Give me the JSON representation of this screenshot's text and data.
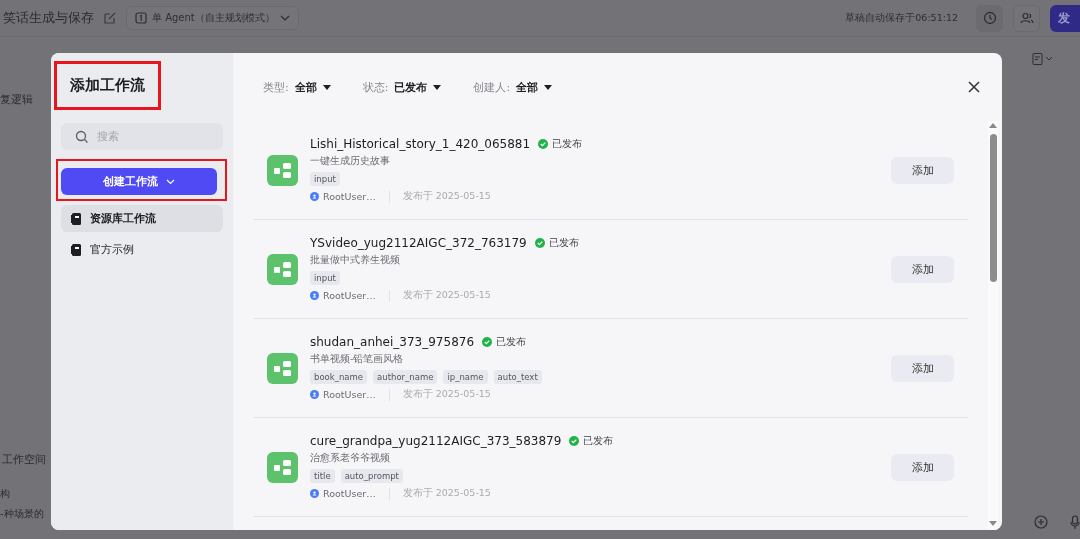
{
  "app_bar": {
    "title": "笑话生成与保存",
    "mode": "单 Agent（自主规划模式）",
    "autosave": "草稿自动保存于06:51:12",
    "publish_button": "发"
  },
  "background_text": {
    "section": "复逻辑",
    "workspace": "工作空间",
    "line_1": "构",
    "line_2": "-种场景的"
  },
  "dialog": {
    "title": "添加工作流",
    "title_highlighted": true,
    "search": {
      "placeholder": "搜索"
    },
    "create_button": "创建工作流",
    "create_highlighted": true,
    "nav": [
      {
        "label": "资源库工作流",
        "selected": true
      },
      {
        "label": "官方示例",
        "selected": false
      }
    ],
    "filters": [
      {
        "label": "类型:",
        "value": "全部"
      },
      {
        "label": "状态:",
        "value": "已发布"
      },
      {
        "label": "创建人:",
        "value": "全部"
      }
    ],
    "workflows": [
      {
        "name": "Lishi_Historical_story_1_420_065881",
        "status": "已发布",
        "description": "一键生成历史故事",
        "tags": [
          "input"
        ],
        "author": "RootUser…",
        "published": "发布于 2025-05-15",
        "button": "添加"
      },
      {
        "name": "YSvideo_yug2112AIGC_372_763179",
        "status": "已发布",
        "description": "批量做中式养生视频",
        "tags": [
          "input"
        ],
        "author": "RootUser…",
        "published": "发布于 2025-05-15",
        "button": "添加"
      },
      {
        "name": "shudan_anhei_373_975876",
        "status": "已发布",
        "description": "书单视频-铅笔画风格",
        "tags": [
          "book_name",
          "author_name",
          "ip_name",
          "auto_text"
        ],
        "author": "RootUser…",
        "published": "发布于 2025-05-15",
        "button": "添加"
      },
      {
        "name": "cure_grandpa_yug2112AIGC_373_583879",
        "status": "已发布",
        "description": "治愈系老爷爷视频",
        "tags": [
          "title",
          "auto_prompt"
        ],
        "author": "RootUser…",
        "published": "发布于 2025-05-15",
        "button": "添加"
      }
    ]
  }
}
